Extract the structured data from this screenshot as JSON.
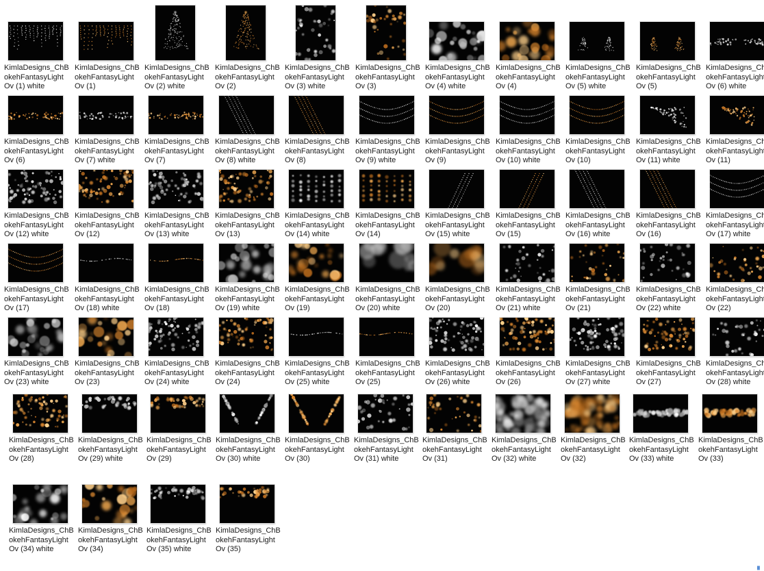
{
  "window": {
    "background": "#ffffff",
    "label_color": "#1a1a1a"
  },
  "icons": {
    "corner": "resize-grip-icon"
  },
  "corner_glyph": "▗",
  "files": [
    {
      "name": "KimlaDesigns_ChBokehFantasyLight Ov (1) white",
      "tone": "white",
      "pattern": "drips"
    },
    {
      "name": "KimlaDesigns_ChBokehFantasyLight Ov (1)",
      "tone": "gold",
      "pattern": "drips"
    },
    {
      "name": "KimlaDesigns_ChBokehFantasyLight Ov (2) white",
      "tone": "white",
      "pattern": "tree",
      "portrait": true
    },
    {
      "name": "KimlaDesigns_ChBokehFantasyLight Ov (2)",
      "tone": "gold",
      "pattern": "tree",
      "portrait": true
    },
    {
      "name": "KimlaDesigns_ChBokehFantasyLight Ov (3) white",
      "tone": "white",
      "pattern": "bokeh-small",
      "portrait": true
    },
    {
      "name": "KimlaDesigns_ChBokehFantasyLight Ov (3)",
      "tone": "gold",
      "pattern": "bokeh-small",
      "portrait": true
    },
    {
      "name": "KimlaDesigns_ChBokehFantasyLight Ov (4) white",
      "tone": "white",
      "pattern": "bokeh-big"
    },
    {
      "name": "KimlaDesigns_ChBokehFantasyLight Ov (4)",
      "tone": "gold",
      "pattern": "bokeh-big"
    },
    {
      "name": "KimlaDesigns_ChBokehFantasyLight Ov (5) white",
      "tone": "white",
      "pattern": "trees"
    },
    {
      "name": "KimlaDesigns_ChBokehFantasyLight Ov (5)",
      "tone": "gold",
      "pattern": "trees"
    },
    {
      "name": "KimlaDesigns_ChBokehFantasyLight Ov (6) white",
      "tone": "white",
      "pattern": "band"
    },
    {
      "name": "KimlaDesigns_ChBokehFantasyLight Ov (6)",
      "tone": "gold",
      "pattern": "band"
    },
    {
      "name": "KimlaDesigns_ChBokehFantasyLight Ov (7) white",
      "tone": "white",
      "pattern": "band"
    },
    {
      "name": "KimlaDesigns_ChBokehFantasyLight Ov (7)",
      "tone": "gold",
      "pattern": "band"
    },
    {
      "name": "KimlaDesigns_ChBokehFantasyLight Ov (8) white",
      "tone": "white",
      "pattern": "diagonal"
    },
    {
      "name": "KimlaDesigns_ChBokehFantasyLight Ov (8)",
      "tone": "gold",
      "pattern": "diagonal"
    },
    {
      "name": "KimlaDesigns_ChBokehFantasyLight Ov (9) white",
      "tone": "white",
      "pattern": "swag"
    },
    {
      "name": "KimlaDesigns_ChBokehFantasyLight Ov (9)",
      "tone": "gold",
      "pattern": "swag"
    },
    {
      "name": "KimlaDesigns_ChBokehFantasyLight Ov (10) white",
      "tone": "white",
      "pattern": "swag"
    },
    {
      "name": "KimlaDesigns_ChBokehFantasyLight Ov (10)",
      "tone": "gold",
      "pattern": "swag"
    },
    {
      "name": "KimlaDesigns_ChBokehFantasyLight Ov (11) white",
      "tone": "white",
      "pattern": "wedge"
    },
    {
      "name": "KimlaDesigns_ChBokehFantasyLight Ov (11)",
      "tone": "gold",
      "pattern": "wedge"
    },
    {
      "name": "KimlaDesigns_ChBokehFantasyLight Ov (12) white",
      "tone": "white",
      "pattern": "curtain"
    },
    {
      "name": "KimlaDesigns_ChBokehFantasyLight Ov (12)",
      "tone": "gold",
      "pattern": "curtain"
    },
    {
      "name": "KimlaDesigns_ChBokehFantasyLight Ov (13) white",
      "tone": "white",
      "pattern": "curtain"
    },
    {
      "name": "KimlaDesigns_ChBokehFantasyLight Ov (13)",
      "tone": "gold",
      "pattern": "curtain"
    },
    {
      "name": "KimlaDesigns_ChBokehFantasyLight Ov (14) white",
      "tone": "white",
      "pattern": "columns"
    },
    {
      "name": "KimlaDesigns_ChBokehFantasyLight Ov (14)",
      "tone": "gold",
      "pattern": "columns"
    },
    {
      "name": "KimlaDesigns_ChBokehFantasyLight Ov (15) white",
      "tone": "white",
      "pattern": "branch"
    },
    {
      "name": "KimlaDesigns_ChBokehFantasyLight Ov (15)",
      "tone": "gold",
      "pattern": "branch"
    },
    {
      "name": "KimlaDesigns_ChBokehFantasyLight Ov (16) white",
      "tone": "white",
      "pattern": "diagonal"
    },
    {
      "name": "KimlaDesigns_ChBokehFantasyLight Ov (16)",
      "tone": "gold",
      "pattern": "diagonal"
    },
    {
      "name": "KimlaDesigns_ChBokehFantasyLight Ov (17) white",
      "tone": "white",
      "pattern": "swag"
    },
    {
      "name": "KimlaDesigns_ChBokehFantasyLight Ov (17)",
      "tone": "gold",
      "pattern": "swag"
    },
    {
      "name": "KimlaDesigns_ChBokehFantasyLight Ov (18) white",
      "tone": "white",
      "pattern": "strand"
    },
    {
      "name": "KimlaDesigns_ChBokehFantasyLight Ov (18)",
      "tone": "gold",
      "pattern": "strand"
    },
    {
      "name": "KimlaDesigns_ChBokehFantasyLight Ov (19) white",
      "tone": "white",
      "pattern": "bokeh-big"
    },
    {
      "name": "KimlaDesigns_ChBokehFantasyLight Ov (19)",
      "tone": "gold",
      "pattern": "bokeh-big"
    },
    {
      "name": "KimlaDesigns_ChBokehFantasyLight Ov (20) white",
      "tone": "white",
      "pattern": "haze"
    },
    {
      "name": "KimlaDesigns_ChBokehFantasyLight Ov (20)",
      "tone": "gold",
      "pattern": "haze"
    },
    {
      "name": "KimlaDesigns_ChBokehFantasyLight Ov (21) white",
      "tone": "white",
      "pattern": "bokeh-small"
    },
    {
      "name": "KimlaDesigns_ChBokehFantasyLight Ov (21)",
      "tone": "gold",
      "pattern": "bokeh-small"
    },
    {
      "name": "KimlaDesigns_ChBokehFantasyLight Ov (22) white",
      "tone": "white",
      "pattern": "bokeh-small"
    },
    {
      "name": "KimlaDesigns_ChBokehFantasyLight Ov (22)",
      "tone": "gold",
      "pattern": "bokeh-small"
    },
    {
      "name": "KimlaDesigns_ChBokehFantasyLight Ov (23) white",
      "tone": "white",
      "pattern": "bokeh-big"
    },
    {
      "name": "KimlaDesigns_ChBokehFantasyLight Ov (23)",
      "tone": "gold",
      "pattern": "bokeh-big"
    },
    {
      "name": "KimlaDesigns_ChBokehFantasyLight Ov (24) white",
      "tone": "white",
      "pattern": "curtain"
    },
    {
      "name": "KimlaDesigns_ChBokehFantasyLight Ov (24)",
      "tone": "gold",
      "pattern": "curtain"
    },
    {
      "name": "KimlaDesigns_ChBokehFantasyLight Ov (25) white",
      "tone": "white",
      "pattern": "strand"
    },
    {
      "name": "KimlaDesigns_ChBokehFantasyLight Ov (25)",
      "tone": "gold",
      "pattern": "strand"
    },
    {
      "name": "KimlaDesigns_ChBokehFantasyLight Ov (26) white",
      "tone": "white",
      "pattern": "curtain"
    },
    {
      "name": "KimlaDesigns_ChBokehFantasyLight Ov (26)",
      "tone": "gold",
      "pattern": "curtain"
    },
    {
      "name": "KimlaDesigns_ChBokehFantasyLight Ov (27) white",
      "tone": "white",
      "pattern": "curtain"
    },
    {
      "name": "KimlaDesigns_ChBokehFantasyLight Ov (27)",
      "tone": "gold",
      "pattern": "curtain"
    },
    {
      "name": "KimlaDesigns_ChBokehFantasyLight Ov (28) white",
      "tone": "white",
      "pattern": "bokeh-small"
    },
    {
      "name": "KimlaDesigns_ChBokehFantasyLight Ov (28)",
      "tone": "gold",
      "pattern": "curtain"
    },
    {
      "name": "KimlaDesigns_ChBokehFantasyLight Ov (29) white",
      "tone": "white",
      "pattern": "top-row"
    },
    {
      "name": "KimlaDesigns_ChBokehFantasyLight Ov (29)",
      "tone": "gold",
      "pattern": "top-row"
    },
    {
      "name": "KimlaDesigns_ChBokehFantasyLight Ov (30) white",
      "tone": "white",
      "pattern": "arch"
    },
    {
      "name": "KimlaDesigns_ChBokehFantasyLight Ov (30)",
      "tone": "gold",
      "pattern": "arch"
    },
    {
      "name": "KimlaDesigns_ChBokehFantasyLight Ov (31) white",
      "tone": "white",
      "pattern": "bokeh-small"
    },
    {
      "name": "KimlaDesigns_ChBokehFantasyLight Ov (31)",
      "tone": "gold",
      "pattern": "bokeh-small"
    },
    {
      "name": "KimlaDesigns_ChBokehFantasyLight Ov (32) white",
      "tone": "white",
      "pattern": "bokeh-dense"
    },
    {
      "name": "KimlaDesigns_ChBokehFantasyLight Ov (32)",
      "tone": "gold",
      "pattern": "bokeh-dense"
    },
    {
      "name": "KimlaDesigns_ChBokehFantasyLight Ov (33) white",
      "tone": "white",
      "pattern": "glow-band"
    },
    {
      "name": "KimlaDesigns_ChBokehFantasyLight Ov (33)",
      "tone": "gold",
      "pattern": "glow-band"
    },
    {
      "name": "KimlaDesigns_ChBokehFantasyLight Ov (34) white",
      "tone": "white",
      "pattern": "bokeh-big"
    },
    {
      "name": "KimlaDesigns_ChBokehFantasyLight Ov (34)",
      "tone": "gold",
      "pattern": "bokeh-big"
    },
    {
      "name": "KimlaDesigns_ChBokehFantasyLight Ov (35) white",
      "tone": "white",
      "pattern": "top-row"
    },
    {
      "name": "KimlaDesigns_ChBokehFantasyLight Ov (35)",
      "tone": "gold",
      "pattern": "top-row"
    }
  ]
}
